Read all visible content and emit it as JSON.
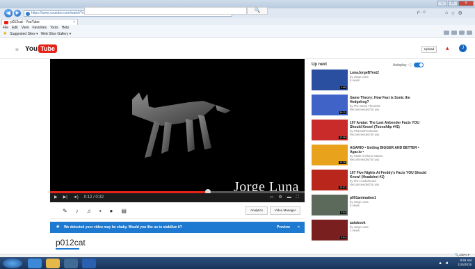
{
  "browser": {
    "address": "https://www.youtube.com/watch?v=0gTcX4vZmTA",
    "search_control": "ρ - c",
    "tab_title": "p012cat - YouTube",
    "tab_close": "×",
    "menu": [
      "File",
      "Edit",
      "View",
      "Favorites",
      "Tools",
      "Help"
    ],
    "favorites": [
      "Suggested Sites ▾",
      "Web Slice Gallery ▾"
    ]
  },
  "youtube": {
    "logo_you": "You",
    "logo_tube": "Tube",
    "search_placeholder": "",
    "search_icon": "🔍",
    "upload_label": "Upload",
    "avatar_letter": "J"
  },
  "player": {
    "watermark": "Jorge Luna",
    "time": "0:12 / 0:32",
    "progress_fraction": 0.62
  },
  "actions": {
    "analytics_label": "Analytics",
    "video_manager_label": "Video Manager"
  },
  "stabilize": {
    "message": "We detected your video may be shaky. Would you like us to stabilize it?",
    "preview_label": "Preview",
    "close_label": "×"
  },
  "video_title": "p012cat",
  "sidebar": {
    "up_next_label": "Up next",
    "autoplay_label": "Autoplay",
    "recommendations": [
      {
        "title": "LunaJorgeBTest2",
        "channel": "by Jorge Luna",
        "meta": "5 views",
        "duration": "0:08",
        "thumb": "#2a4fa0"
      },
      {
        "title": "Game Theory: How Fast is Sonic the Hedgehog?",
        "channel": "by The Game Theorists",
        "meta": "Recommended for you",
        "duration": "14:11",
        "thumb": "#3f63c7"
      },
      {
        "title": "107 Avatar: The Last Airbender Facts YOU Should Know! (Toonsfdip #41)",
        "channel": "by ChannelFrederator",
        "meta": "Recommended for you",
        "duration": "12:38",
        "thumb": "#c92a2a"
      },
      {
        "title": "AGARIO • Getting BIGGER AND BETTER • Agar.io •",
        "channel": "by Clash of Clans Attacks",
        "meta": "Recommended for you",
        "duration": "10:26",
        "thumb": "#e8a21c"
      },
      {
        "title": "107 Five Nights At Freddy's Facts YOU Should Know! (Headshot #1)",
        "channel": "by The Leaderboard",
        "meta": "Recommended for you",
        "duration": "13:01",
        "thumb": "#b9261c"
      },
      {
        "title": "p001animation1",
        "channel": "by Jorge Luna",
        "meta": "5 views",
        "duration": "0:04",
        "thumb": "#5b6a5a"
      },
      {
        "title": "autobook",
        "channel": "by Jorge Luna",
        "meta": "1 views",
        "duration": "0:04",
        "thumb": "#7a1f1f"
      }
    ]
  },
  "statusbar": {
    "zoom": "🔍100% ▾"
  },
  "taskbar": {
    "time": "8:26 AM",
    "date": "11/5/2015"
  }
}
